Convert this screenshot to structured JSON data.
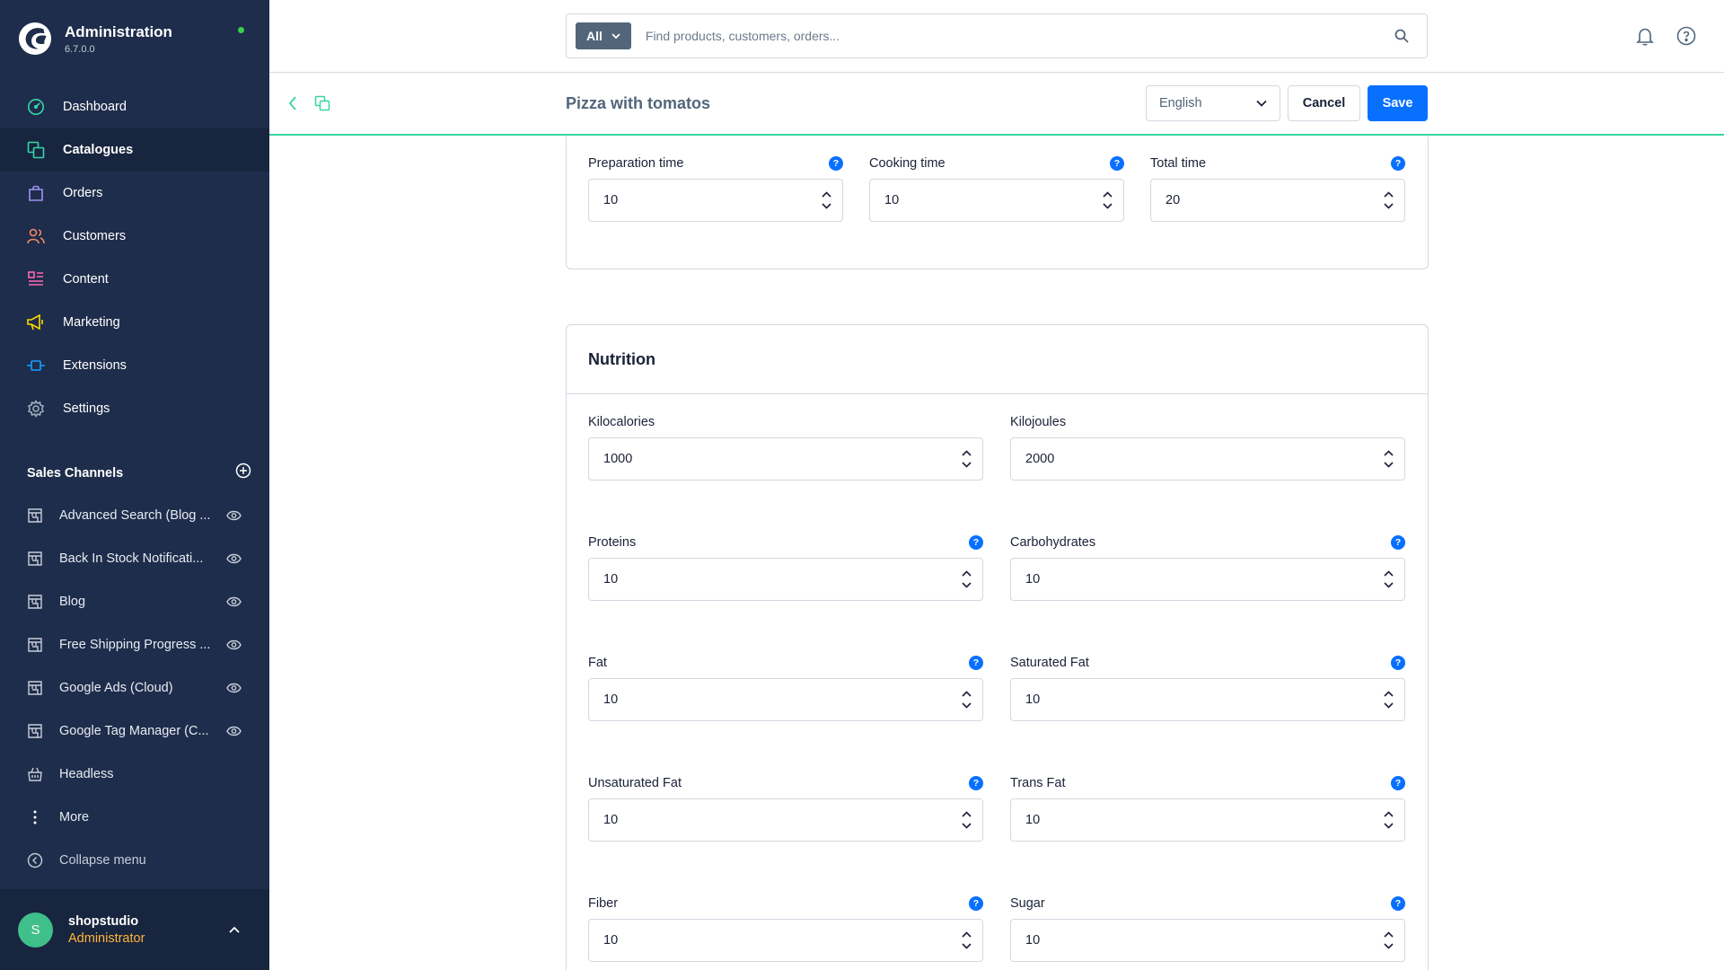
{
  "app": {
    "title": "Administration",
    "version": "6.7.0.0"
  },
  "nav": [
    {
      "label": "Dashboard",
      "icon": "dashboard-icon"
    },
    {
      "label": "Catalogues",
      "icon": "catalogue-icon"
    },
    {
      "label": "Orders",
      "icon": "orders-icon"
    },
    {
      "label": "Customers",
      "icon": "customers-icon"
    },
    {
      "label": "Content",
      "icon": "content-icon"
    },
    {
      "label": "Marketing",
      "icon": "marketing-icon"
    },
    {
      "label": "Extensions",
      "icon": "extensions-icon"
    },
    {
      "label": "Settings",
      "icon": "settings-icon"
    }
  ],
  "sales_channels": {
    "title": "Sales Channels",
    "items": [
      {
        "label": "Advanced Search (Blog ..."
      },
      {
        "label": "Back In Stock Notificati..."
      },
      {
        "label": "Blog"
      },
      {
        "label": "Free Shipping Progress ..."
      },
      {
        "label": "Google Ads (Cloud)"
      },
      {
        "label": "Google Tag Manager (C..."
      },
      {
        "label": "Headless"
      }
    ],
    "more_label": "More",
    "collapse_label": "Collapse menu"
  },
  "user": {
    "initial": "S",
    "name": "shopstudio",
    "role": "Administrator"
  },
  "search": {
    "type_label": "All",
    "placeholder": "Find products, customers, orders..."
  },
  "smartbar": {
    "title": "Pizza with tomatos",
    "language": "English",
    "cancel_label": "Cancel",
    "save_label": "Save"
  },
  "times": {
    "preparation": {
      "label": "Preparation time",
      "value": "10"
    },
    "cooking": {
      "label": "Cooking time",
      "value": "10"
    },
    "total": {
      "label": "Total time",
      "value": "20"
    }
  },
  "nutrition": {
    "title": "Nutrition",
    "kcal": {
      "label": "Kilocalories",
      "value": "1000"
    },
    "kj": {
      "label": "Kilojoules",
      "value": "2000"
    },
    "proteins": {
      "label": "Proteins",
      "value": "10"
    },
    "carbohydrates": {
      "label": "Carbohydrates",
      "value": "10"
    },
    "fat": {
      "label": "Fat",
      "value": "10"
    },
    "saturated_fat": {
      "label": "Saturated Fat",
      "value": "10"
    },
    "unsaturated_fat": {
      "label": "Unsaturated Fat",
      "value": "10"
    },
    "trans_fat": {
      "label": "Trans Fat",
      "value": "10"
    },
    "fiber": {
      "label": "Fiber",
      "value": "10"
    },
    "sugar": {
      "label": "Sugar",
      "value": "10"
    }
  },
  "help_glyph": "?",
  "colors": {
    "sidebar_bg": "#1e2d4b",
    "primary": "#0870ff",
    "accent_green": "#37d5a5",
    "role_orange": "#ffb637"
  }
}
